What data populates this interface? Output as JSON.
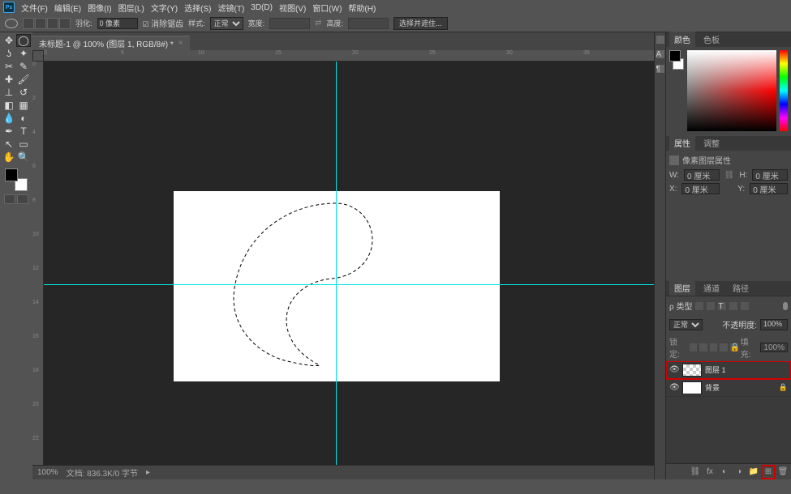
{
  "menubar": {
    "items": [
      "文件(F)",
      "编辑(E)",
      "图像(I)",
      "图层(L)",
      "文字(Y)",
      "选择(S)",
      "滤镜(T)",
      "3D(D)",
      "视图(V)",
      "窗口(W)",
      "帮助(H)"
    ]
  },
  "optionsbar": {
    "feather_label": "羽化:",
    "feather_value": "0 像素",
    "antialias_label": "消除锯齿",
    "style_label": "样式:",
    "style_value": "正常",
    "width_label": "宽度:",
    "height_label": "高度:",
    "refine_label": "选择并遮住..."
  },
  "document": {
    "tab_title": "未标题-1 @ 100% (图层 1, RGB/8#) *"
  },
  "ruler_ticks_h": [
    "0",
    "5",
    "10",
    "15",
    "20",
    "25",
    "30",
    "35"
  ],
  "ruler_ticks_v": [
    "0",
    "2",
    "4",
    "6",
    "8",
    "10",
    "12",
    "14",
    "16",
    "18",
    "20",
    "22"
  ],
  "statusbar": {
    "zoom": "100%",
    "docinfo": "文档: 836.3K/0 字节"
  },
  "color_tabs": {
    "color": "颜色",
    "swatches": "色板"
  },
  "props_tabs": {
    "props": "属性",
    "adjust": "调整"
  },
  "props": {
    "header": "像素图层属性",
    "w_label": "W:",
    "w_value": "0 厘米",
    "h_label": "H:",
    "h_value": "0 厘米",
    "x_label": "X:",
    "x_value": "0 厘米",
    "y_label": "Y:",
    "y_value": "0 厘米"
  },
  "layers_tabs": {
    "layers": "图层",
    "channels": "通道",
    "paths": "路径"
  },
  "layers": {
    "kind_label": "ρ 类型",
    "blend_mode": "正常",
    "opacity_label": "不透明度:",
    "opacity_value": "100%",
    "lock_label": "锁定:",
    "fill_label": "填充:",
    "fill_value": "100%",
    "rows": [
      {
        "name": "图层 1",
        "transparent": true,
        "highlighted": true,
        "locked": false
      },
      {
        "name": "背景",
        "transparent": false,
        "highlighted": false,
        "locked": true
      }
    ]
  },
  "tools": [
    [
      "move",
      "marquee-ellipse"
    ],
    [
      "lasso",
      "magic-wand"
    ],
    [
      "crop",
      "eyedropper"
    ],
    [
      "spot-heal",
      "brush"
    ],
    [
      "stamp",
      "history-brush"
    ],
    [
      "eraser",
      "gradient"
    ],
    [
      "blur",
      "dodge"
    ],
    [
      "pen",
      "type"
    ],
    [
      "path-select",
      "rect-shape"
    ],
    [
      "hand",
      "zoom"
    ]
  ],
  "tool_glyphs": {
    "move": "✥",
    "marquee-ellipse": "◯",
    "lasso": "ʖ",
    "magic-wand": "✦",
    "crop": "✂",
    "eyedropper": "✎",
    "spot-heal": "✚",
    "brush": "🖌",
    "stamp": "⊥",
    "history-brush": "↺",
    "eraser": "◧",
    "gradient": "▦",
    "blur": "💧",
    "dodge": "◐",
    "pen": "✒",
    "type": "T",
    "path-select": "↖",
    "rect-shape": "▭",
    "hand": "✋",
    "zoom": "🔍"
  }
}
